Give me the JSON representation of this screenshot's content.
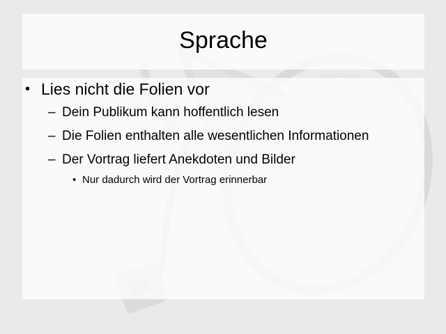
{
  "slide": {
    "title": "Sprache",
    "bullets": [
      {
        "text": "Lies nicht die Folien vor",
        "marker": "•",
        "children": [
          {
            "text": "Dein Publikum kann hoffentlich lesen",
            "marker": "–"
          },
          {
            "text": "Die Folien enthalten alle wesentlichen Informationen",
            "marker": "–"
          },
          {
            "text": "Der Vortrag liefert Anekdoten und Bilder",
            "marker": "–",
            "children": [
              {
                "text": "Nur dadurch wird der Vortrag erinnerbar",
                "marker": "•"
              }
            ]
          }
        ]
      }
    ]
  },
  "background": {
    "image": "megaphone-illustration",
    "page_color": "#ebe9ea",
    "panel_color": "#ffffff"
  }
}
